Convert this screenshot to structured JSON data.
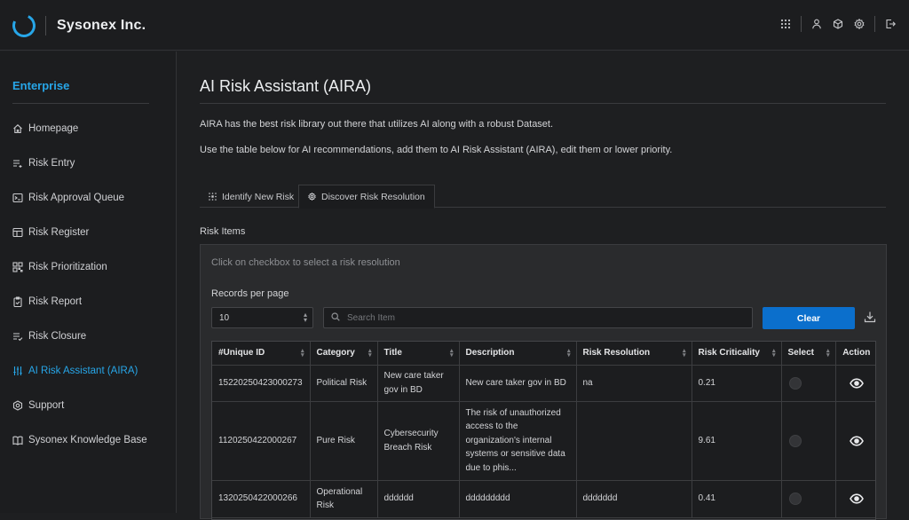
{
  "app": {
    "brand": "Sysonex Inc.",
    "accent": "#27a6e8"
  },
  "topbar_icons": [
    "apps-grid-icon",
    "user-icon",
    "cube-icon",
    "settings-icon",
    "logout-icon"
  ],
  "sidebar": {
    "title": "Enterprise",
    "items": [
      {
        "label": "Homepage",
        "icon": "home-icon"
      },
      {
        "label": "Risk Entry",
        "icon": "list-add-icon"
      },
      {
        "label": "Risk Approval Queue",
        "icon": "terminal-icon"
      },
      {
        "label": "Risk Register",
        "icon": "table-icon"
      },
      {
        "label": "Risk Prioritization",
        "icon": "grid-icon"
      },
      {
        "label": "Risk Report",
        "icon": "clipboard-icon"
      },
      {
        "label": "Risk Closure",
        "icon": "list-check-icon"
      },
      {
        "label": "AI Risk Assistant (AIRA)",
        "icon": "sliders-icon",
        "active": true
      },
      {
        "label": "Support",
        "icon": "support-icon"
      },
      {
        "label": "Sysonex Knowledge Base",
        "icon": "book-icon"
      }
    ]
  },
  "main": {
    "title": "AI Risk Assistant (AIRA)",
    "desc1": "AIRA has the best risk library out there that utilizes AI along with a robust Dataset.",
    "desc2": "Use the table below for AI recommendations, add them to AI Risk Assistant (AIRA), edit them or lower priority.",
    "tabs": [
      {
        "label": "Identify New Risk",
        "icon": "dotted-grid-icon"
      },
      {
        "label": "Discover Risk Resolution",
        "icon": "settings-icon",
        "active": true
      }
    ],
    "section_label": "Risk Items",
    "hint": "Click on checkbox to select a risk resolution",
    "records_label": "Records per page",
    "records_value": "10",
    "search_placeholder": "Search Item",
    "clear_label": "Clear",
    "table": {
      "headers": [
        "#Unique ID",
        "Category",
        "Title",
        "Description",
        "Risk Resolution",
        "Risk Criticality",
        "Select",
        "Action"
      ],
      "rows": [
        {
          "id": "15220250423000273",
          "category": "Political Risk",
          "title": "New care taker gov in BD",
          "description": "New care taker gov in BD",
          "resolution": "na",
          "criticality": "0.21"
        },
        {
          "id": "1120250422000267",
          "category": "Pure Risk",
          "title": "Cybersecurity Breach Risk",
          "description": "The risk of unauthorized access to the organization's internal systems or sensitive data due to phis...",
          "resolution": "",
          "criticality": "9.61"
        },
        {
          "id": "1320250422000266",
          "category": "Operational Risk",
          "title": "dddddd",
          "description": "ddddddddd",
          "resolution": "ddddddd",
          "criticality": "0.41"
        }
      ]
    }
  }
}
